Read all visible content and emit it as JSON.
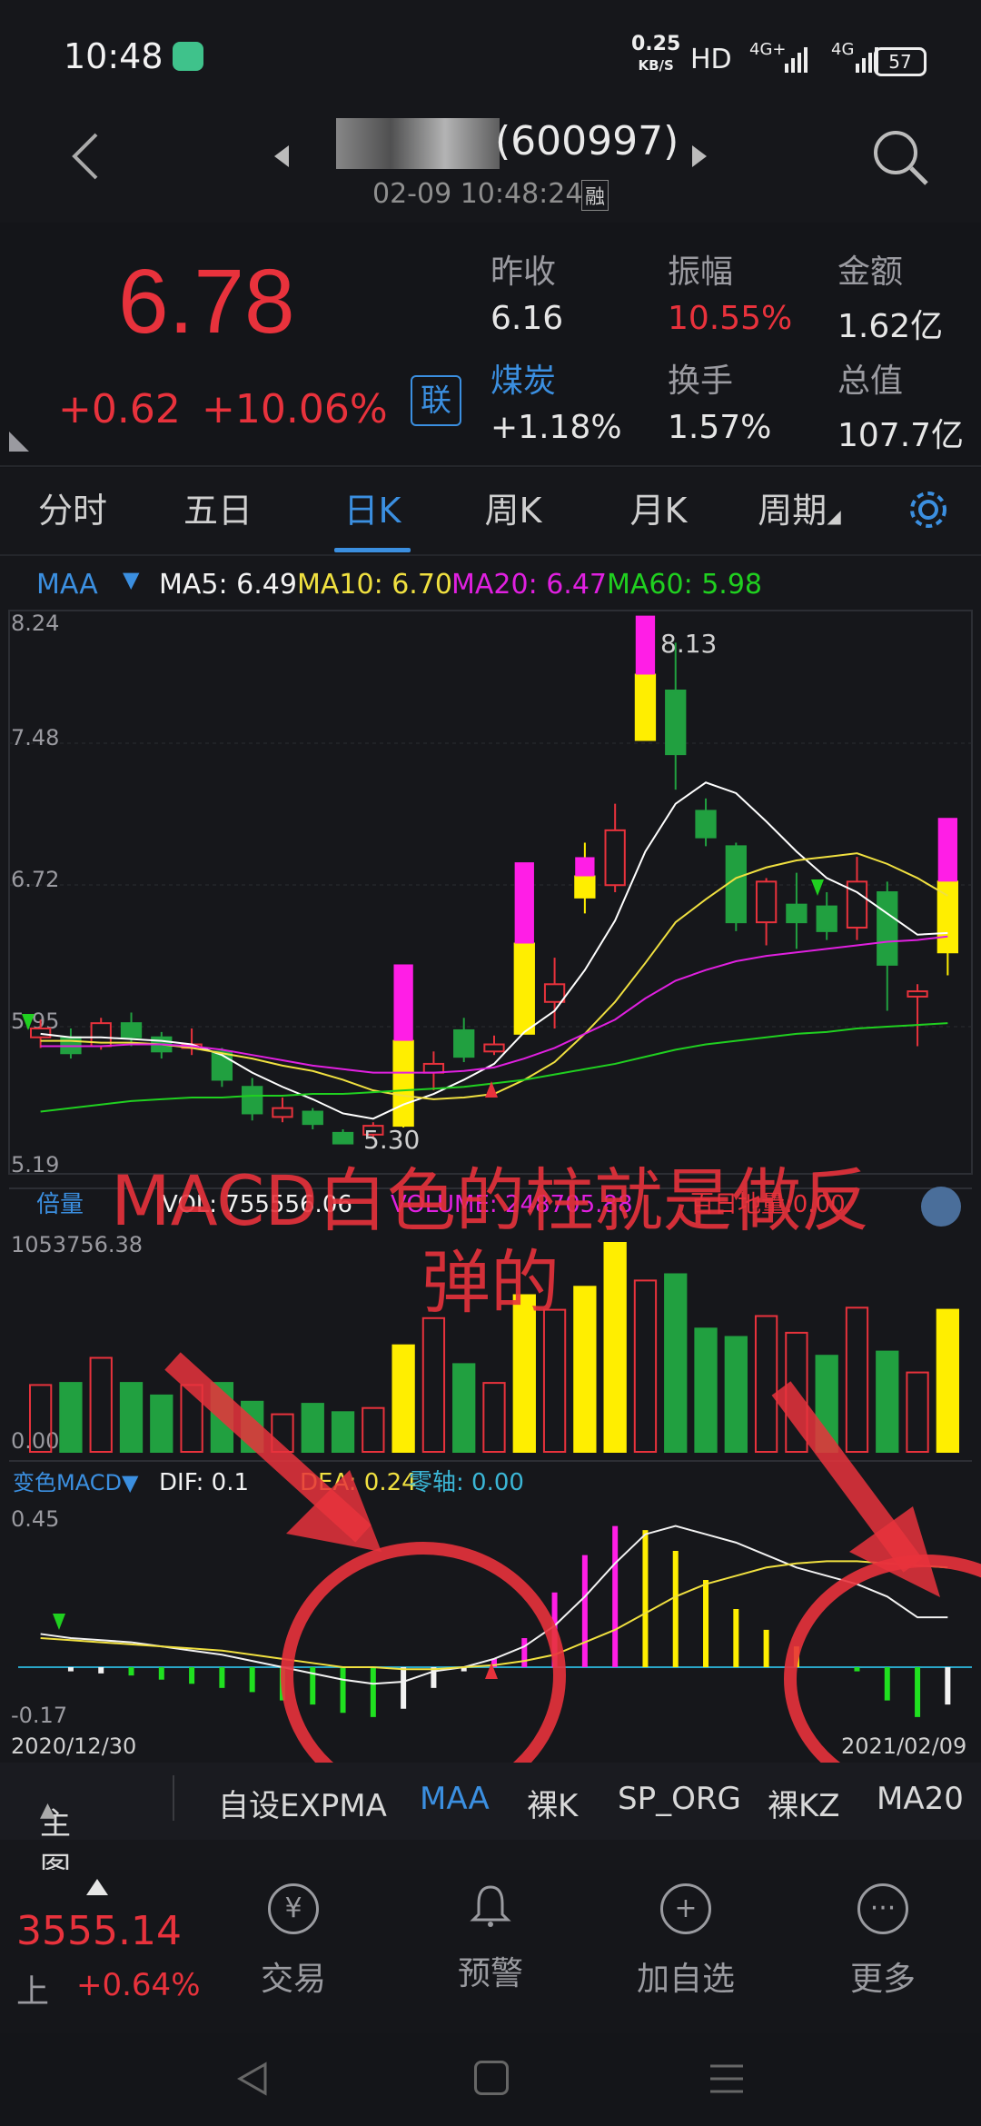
{
  "status_bar": {
    "time": "10:48",
    "net_speed_value": "0.25",
    "net_speed_unit": "KB/S",
    "hd_label": "HD",
    "signal1_label": "4G+",
    "signal2_label": "4G",
    "battery": "57"
  },
  "header": {
    "stock_code": "(600997)",
    "timestamp": "02-09 10:48:24",
    "margin_badge": "融"
  },
  "quote": {
    "price": "6.78",
    "change": "+0.62",
    "change_pct": "+10.06%",
    "link_badge": "联",
    "prev_close_label": "昨收",
    "prev_close": "6.16",
    "amplitude_label": "振幅",
    "amplitude": "10.55%",
    "amount_label": "金额",
    "amount": "1.62亿",
    "sector_label": "煤炭",
    "sector_change": "+1.18%",
    "turnover_label": "换手",
    "turnover": "1.57%",
    "market_cap_label": "总值",
    "market_cap": "107.7亿"
  },
  "tabs": [
    "分时",
    "五日",
    "日K",
    "周K",
    "月K",
    "周期"
  ],
  "indicators": {
    "maa_label": "MAA",
    "ma5": "MA5: 6.49",
    "ma10": "MA10: 6.70",
    "ma20": "MA20: 6.47",
    "ma60": "MA60: 5.98",
    "volume_label": "倍量",
    "vol_text": "VOL: 755556.06",
    "volume_text": "VOLUME: 248705.88",
    "extra_text": "百日地量:0.00",
    "macd_label": "变色MACD▼",
    "dif": "DIF: 0.1",
    "dea": "DEA: 0.24",
    "zero_axis": "零轴: 0.00"
  },
  "chart_data": {
    "type": "candlestick",
    "price_axis": [
      "8.24",
      "7.48",
      "6.72",
      "5.95",
      "5.19"
    ],
    "price_range": [
      5.19,
      8.24
    ],
    "high_label": "8.13",
    "low_label": "5.30",
    "volume_axis_top": "1053756.38",
    "volume_axis_bottom": "0.00",
    "macd_axis_top": "0.45",
    "macd_axis_bottom": "-0.17",
    "start_date": "2020/12/30",
    "end_date": "2021/02/09",
    "candles": [
      {
        "o": 5.95,
        "c": 5.9,
        "h": 6.0,
        "l": 5.84,
        "col": "r"
      },
      {
        "o": 5.9,
        "c": 5.81,
        "h": 5.95,
        "l": 5.78,
        "col": "g"
      },
      {
        "o": 5.85,
        "c": 5.98,
        "h": 6.01,
        "l": 5.83,
        "col": "r"
      },
      {
        "o": 5.98,
        "c": 5.9,
        "h": 6.04,
        "l": 5.85,
        "col": "g"
      },
      {
        "o": 5.9,
        "c": 5.82,
        "h": 5.93,
        "l": 5.78,
        "col": "g"
      },
      {
        "o": 5.84,
        "c": 5.86,
        "h": 5.95,
        "l": 5.8,
        "col": "r"
      },
      {
        "o": 5.82,
        "c": 5.66,
        "h": 5.84,
        "l": 5.62,
        "col": "g"
      },
      {
        "o": 5.62,
        "c": 5.47,
        "h": 5.67,
        "l": 5.43,
        "col": "g"
      },
      {
        "o": 5.45,
        "c": 5.5,
        "h": 5.56,
        "l": 5.42,
        "col": "r"
      },
      {
        "o": 5.48,
        "c": 5.41,
        "h": 5.5,
        "l": 5.38,
        "col": "g"
      },
      {
        "o": 5.36,
        "c": 5.3,
        "h": 5.38,
        "l": 5.3,
        "col": "g"
      },
      {
        "o": 5.35,
        "c": 5.4,
        "h": 5.42,
        "l": 5.33,
        "col": "r"
      },
      {
        "o": 5.4,
        "c": 5.88,
        "h": 5.88,
        "l": 5.39,
        "col": "y"
      },
      {
        "o": 5.75,
        "c": 5.7,
        "h": 5.82,
        "l": 5.6,
        "col": "r"
      },
      {
        "o": 5.94,
        "c": 5.79,
        "h": 6.01,
        "l": 5.76,
        "col": "g"
      },
      {
        "o": 5.82,
        "c": 5.86,
        "h": 5.91,
        "l": 5.8,
        "col": "r"
      },
      {
        "o": 5.92,
        "c": 6.43,
        "h": 6.43,
        "l": 5.92,
        "col": "y"
      },
      {
        "o": 6.1,
        "c": 6.2,
        "h": 6.35,
        "l": 5.95,
        "col": "r"
      },
      {
        "o": 6.69,
        "c": 6.81,
        "h": 7.0,
        "l": 6.6,
        "col": "y"
      },
      {
        "o": 6.76,
        "c": 7.07,
        "h": 7.22,
        "l": 6.72,
        "col": "r"
      },
      {
        "o": 7.58,
        "c": 7.95,
        "h": 7.95,
        "l": 7.58,
        "col": "y"
      },
      {
        "o": 7.86,
        "c": 7.5,
        "h": 8.13,
        "l": 7.3,
        "col": "g"
      },
      {
        "o": 7.18,
        "c": 7.03,
        "h": 7.25,
        "l": 6.98,
        "col": "g"
      },
      {
        "o": 6.98,
        "c": 6.55,
        "h": 7.0,
        "l": 6.5,
        "col": "g"
      },
      {
        "o": 6.55,
        "c": 6.78,
        "h": 6.8,
        "l": 6.42,
        "col": "r"
      },
      {
        "o": 6.65,
        "c": 6.55,
        "h": 6.83,
        "l": 6.4,
        "col": "g"
      },
      {
        "o": 6.64,
        "c": 6.5,
        "h": 6.72,
        "l": 6.45,
        "col": "g"
      },
      {
        "o": 6.52,
        "c": 6.78,
        "h": 6.92,
        "l": 6.45,
        "col": "r"
      },
      {
        "o": 6.72,
        "c": 6.31,
        "h": 6.78,
        "l": 6.05,
        "col": "g"
      },
      {
        "o": 6.13,
        "c": 6.16,
        "h": 6.2,
        "l": 5.85,
        "col": "r"
      },
      {
        "o": 6.78,
        "c": 6.38,
        "h": 6.78,
        "l": 6.25,
        "col": "y"
      }
    ],
    "ma_lines": [
      {
        "name": "MA5",
        "color": "#ffffff",
        "values": [
          5.92,
          5.9,
          5.9,
          5.89,
          5.88,
          5.86,
          5.8,
          5.7,
          5.62,
          5.55,
          5.47,
          5.44,
          5.52,
          5.58,
          5.66,
          5.75,
          5.93,
          6.05,
          6.28,
          6.56,
          6.95,
          7.22,
          7.34,
          7.28,
          7.12,
          6.95,
          6.8,
          6.72,
          6.6,
          6.48,
          6.49
        ]
      },
      {
        "name": "MA10",
        "color": "#f0e040",
        "values": [
          5.88,
          5.88,
          5.87,
          5.87,
          5.86,
          5.84,
          5.81,
          5.78,
          5.74,
          5.71,
          5.66,
          5.6,
          5.57,
          5.55,
          5.56,
          5.58,
          5.66,
          5.76,
          5.92,
          6.1,
          6.32,
          6.55,
          6.68,
          6.8,
          6.86,
          6.9,
          6.92,
          6.94,
          6.88,
          6.8,
          6.7
        ]
      },
      {
        "name": "MA20",
        "color": "#e020e0",
        "values": [
          5.85,
          5.85,
          5.85,
          5.86,
          5.86,
          5.85,
          5.83,
          5.8,
          5.77,
          5.74,
          5.72,
          5.7,
          5.7,
          5.7,
          5.71,
          5.73,
          5.78,
          5.84,
          5.92,
          6.0,
          6.12,
          6.22,
          6.28,
          6.33,
          6.36,
          6.38,
          6.4,
          6.42,
          6.44,
          6.45,
          6.47
        ]
      },
      {
        "name": "MA60",
        "color": "#20d020",
        "values": [
          5.48,
          5.5,
          5.52,
          5.54,
          5.55,
          5.56,
          5.56,
          5.57,
          5.57,
          5.58,
          5.58,
          5.59,
          5.6,
          5.61,
          5.62,
          5.64,
          5.66,
          5.69,
          5.72,
          5.75,
          5.79,
          5.83,
          5.86,
          5.88,
          5.9,
          5.92,
          5.93,
          5.95,
          5.96,
          5.97,
          5.98
        ]
      }
    ],
    "volumes": [
      {
        "v": 0.32,
        "col": "r"
      },
      {
        "v": 0.33,
        "col": "g"
      },
      {
        "v": 0.45,
        "col": "r"
      },
      {
        "v": 0.33,
        "col": "g"
      },
      {
        "v": 0.27,
        "col": "g"
      },
      {
        "v": 0.32,
        "col": "r"
      },
      {
        "v": 0.33,
        "col": "g"
      },
      {
        "v": 0.24,
        "col": "g"
      },
      {
        "v": 0.18,
        "col": "r"
      },
      {
        "v": 0.23,
        "col": "g"
      },
      {
        "v": 0.19,
        "col": "g"
      },
      {
        "v": 0.21,
        "col": "r"
      },
      {
        "v": 0.51,
        "col": "y"
      },
      {
        "v": 0.64,
        "col": "r"
      },
      {
        "v": 0.42,
        "col": "g"
      },
      {
        "v": 0.33,
        "col": "r"
      },
      {
        "v": 0.75,
        "col": "y"
      },
      {
        "v": 0.68,
        "col": "r"
      },
      {
        "v": 0.79,
        "col": "y"
      },
      {
        "v": 1.0,
        "col": "y"
      },
      {
        "v": 0.82,
        "col": "r"
      },
      {
        "v": 0.85,
        "col": "g"
      },
      {
        "v": 0.59,
        "col": "g"
      },
      {
        "v": 0.55,
        "col": "g"
      },
      {
        "v": 0.65,
        "col": "r"
      },
      {
        "v": 0.57,
        "col": "r"
      },
      {
        "v": 0.46,
        "col": "g"
      },
      {
        "v": 0.69,
        "col": "r"
      },
      {
        "v": 0.48,
        "col": "g"
      },
      {
        "v": 0.38,
        "col": "r"
      },
      {
        "v": 0.68,
        "col": "y"
      }
    ],
    "macd_bars": [
      {
        "v": 0.0,
        "col": "w"
      },
      {
        "v": -0.01,
        "col": "w"
      },
      {
        "v": -0.015,
        "col": "w"
      },
      {
        "v": -0.02,
        "col": "g"
      },
      {
        "v": -0.03,
        "col": "g"
      },
      {
        "v": -0.04,
        "col": "g"
      },
      {
        "v": -0.05,
        "col": "g"
      },
      {
        "v": -0.06,
        "col": "g"
      },
      {
        "v": -0.08,
        "col": "g"
      },
      {
        "v": -0.09,
        "col": "g"
      },
      {
        "v": -0.11,
        "col": "g"
      },
      {
        "v": -0.12,
        "col": "g"
      },
      {
        "v": -0.1,
        "col": "w"
      },
      {
        "v": -0.05,
        "col": "w"
      },
      {
        "v": -0.01,
        "col": "w"
      },
      {
        "v": 0.02,
        "col": "m"
      },
      {
        "v": 0.07,
        "col": "m"
      },
      {
        "v": 0.18,
        "col": "m"
      },
      {
        "v": 0.27,
        "col": "m"
      },
      {
        "v": 0.34,
        "col": "m"
      },
      {
        "v": 0.33,
        "col": "y"
      },
      {
        "v": 0.28,
        "col": "y"
      },
      {
        "v": 0.21,
        "col": "y"
      },
      {
        "v": 0.14,
        "col": "y"
      },
      {
        "v": 0.09,
        "col": "y"
      },
      {
        "v": 0.05,
        "col": "y"
      },
      {
        "v": 0.0,
        "col": "y"
      },
      {
        "v": -0.01,
        "col": "g"
      },
      {
        "v": -0.08,
        "col": "g"
      },
      {
        "v": -0.12,
        "col": "g"
      },
      {
        "v": -0.09,
        "col": "w"
      }
    ],
    "dif": [
      0.08,
      0.07,
      0.065,
      0.06,
      0.05,
      0.04,
      0.03,
      0.015,
      0.0,
      -0.015,
      -0.03,
      -0.04,
      -0.035,
      -0.01,
      0.0,
      0.02,
      0.05,
      0.1,
      0.17,
      0.25,
      0.32,
      0.34,
      0.32,
      0.3,
      0.27,
      0.24,
      0.22,
      0.2,
      0.17,
      0.12,
      0.12
    ],
    "dea": [
      0.07,
      0.065,
      0.06,
      0.055,
      0.05,
      0.045,
      0.04,
      0.03,
      0.02,
      0.01,
      0.0,
      0.0,
      -0.005,
      -0.005,
      0.0,
      0.005,
      0.015,
      0.03,
      0.06,
      0.09,
      0.13,
      0.17,
      0.2,
      0.22,
      0.24,
      0.25,
      0.255,
      0.255,
      0.25,
      0.245,
      0.24
    ]
  },
  "annotation": {
    "line1": "MACD白色的柱就是做反",
    "line2": "弹的"
  },
  "bottom_toolbar": {
    "main_chart": "主图",
    "items": [
      "自设EXPMA",
      "MAA",
      "裸K",
      "SP_ORG",
      "裸KZ",
      "MA20"
    ]
  },
  "bottom_nav": {
    "index_value": "3555.14",
    "index_prefix": "上",
    "index_change": "+0.64%",
    "trade": "交易",
    "alert": "预警",
    "add_watch": "加自选",
    "more": "更多"
  }
}
